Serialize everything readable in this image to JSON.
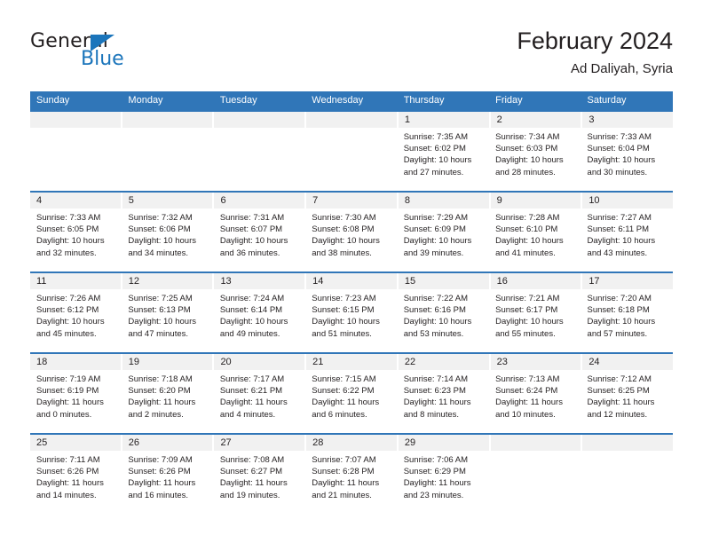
{
  "brand": {
    "name_part1": "General",
    "name_part2": "Blue"
  },
  "header": {
    "title": "February 2024",
    "location": "Ad Daliyah, Syria"
  },
  "colors": {
    "header_blue": "#3076b8",
    "brand_blue": "#1b75bb",
    "daynum_band": "#f1f1f1",
    "text": "#231f20"
  },
  "weekdays": [
    "Sunday",
    "Monday",
    "Tuesday",
    "Wednesday",
    "Thursday",
    "Friday",
    "Saturday"
  ],
  "weeks": [
    [
      {
        "day": "",
        "sunrise": "",
        "sunset": "",
        "daylight": ""
      },
      {
        "day": "",
        "sunrise": "",
        "sunset": "",
        "daylight": ""
      },
      {
        "day": "",
        "sunrise": "",
        "sunset": "",
        "daylight": ""
      },
      {
        "day": "",
        "sunrise": "",
        "sunset": "",
        "daylight": ""
      },
      {
        "day": "1",
        "sunrise": "Sunrise: 7:35 AM",
        "sunset": "Sunset: 6:02 PM",
        "daylight": "Daylight: 10 hours and 27 minutes."
      },
      {
        "day": "2",
        "sunrise": "Sunrise: 7:34 AM",
        "sunset": "Sunset: 6:03 PM",
        "daylight": "Daylight: 10 hours and 28 minutes."
      },
      {
        "day": "3",
        "sunrise": "Sunrise: 7:33 AM",
        "sunset": "Sunset: 6:04 PM",
        "daylight": "Daylight: 10 hours and 30 minutes."
      }
    ],
    [
      {
        "day": "4",
        "sunrise": "Sunrise: 7:33 AM",
        "sunset": "Sunset: 6:05 PM",
        "daylight": "Daylight: 10 hours and 32 minutes."
      },
      {
        "day": "5",
        "sunrise": "Sunrise: 7:32 AM",
        "sunset": "Sunset: 6:06 PM",
        "daylight": "Daylight: 10 hours and 34 minutes."
      },
      {
        "day": "6",
        "sunrise": "Sunrise: 7:31 AM",
        "sunset": "Sunset: 6:07 PM",
        "daylight": "Daylight: 10 hours and 36 minutes."
      },
      {
        "day": "7",
        "sunrise": "Sunrise: 7:30 AM",
        "sunset": "Sunset: 6:08 PM",
        "daylight": "Daylight: 10 hours and 38 minutes."
      },
      {
        "day": "8",
        "sunrise": "Sunrise: 7:29 AM",
        "sunset": "Sunset: 6:09 PM",
        "daylight": "Daylight: 10 hours and 39 minutes."
      },
      {
        "day": "9",
        "sunrise": "Sunrise: 7:28 AM",
        "sunset": "Sunset: 6:10 PM",
        "daylight": "Daylight: 10 hours and 41 minutes."
      },
      {
        "day": "10",
        "sunrise": "Sunrise: 7:27 AM",
        "sunset": "Sunset: 6:11 PM",
        "daylight": "Daylight: 10 hours and 43 minutes."
      }
    ],
    [
      {
        "day": "11",
        "sunrise": "Sunrise: 7:26 AM",
        "sunset": "Sunset: 6:12 PM",
        "daylight": "Daylight: 10 hours and 45 minutes."
      },
      {
        "day": "12",
        "sunrise": "Sunrise: 7:25 AM",
        "sunset": "Sunset: 6:13 PM",
        "daylight": "Daylight: 10 hours and 47 minutes."
      },
      {
        "day": "13",
        "sunrise": "Sunrise: 7:24 AM",
        "sunset": "Sunset: 6:14 PM",
        "daylight": "Daylight: 10 hours and 49 minutes."
      },
      {
        "day": "14",
        "sunrise": "Sunrise: 7:23 AM",
        "sunset": "Sunset: 6:15 PM",
        "daylight": "Daylight: 10 hours and 51 minutes."
      },
      {
        "day": "15",
        "sunrise": "Sunrise: 7:22 AM",
        "sunset": "Sunset: 6:16 PM",
        "daylight": "Daylight: 10 hours and 53 minutes."
      },
      {
        "day": "16",
        "sunrise": "Sunrise: 7:21 AM",
        "sunset": "Sunset: 6:17 PM",
        "daylight": "Daylight: 10 hours and 55 minutes."
      },
      {
        "day": "17",
        "sunrise": "Sunrise: 7:20 AM",
        "sunset": "Sunset: 6:18 PM",
        "daylight": "Daylight: 10 hours and 57 minutes."
      }
    ],
    [
      {
        "day": "18",
        "sunrise": "Sunrise: 7:19 AM",
        "sunset": "Sunset: 6:19 PM",
        "daylight": "Daylight: 11 hours and 0 minutes."
      },
      {
        "day": "19",
        "sunrise": "Sunrise: 7:18 AM",
        "sunset": "Sunset: 6:20 PM",
        "daylight": "Daylight: 11 hours and 2 minutes."
      },
      {
        "day": "20",
        "sunrise": "Sunrise: 7:17 AM",
        "sunset": "Sunset: 6:21 PM",
        "daylight": "Daylight: 11 hours and 4 minutes."
      },
      {
        "day": "21",
        "sunrise": "Sunrise: 7:15 AM",
        "sunset": "Sunset: 6:22 PM",
        "daylight": "Daylight: 11 hours and 6 minutes."
      },
      {
        "day": "22",
        "sunrise": "Sunrise: 7:14 AM",
        "sunset": "Sunset: 6:23 PM",
        "daylight": "Daylight: 11 hours and 8 minutes."
      },
      {
        "day": "23",
        "sunrise": "Sunrise: 7:13 AM",
        "sunset": "Sunset: 6:24 PM",
        "daylight": "Daylight: 11 hours and 10 minutes."
      },
      {
        "day": "24",
        "sunrise": "Sunrise: 7:12 AM",
        "sunset": "Sunset: 6:25 PM",
        "daylight": "Daylight: 11 hours and 12 minutes."
      }
    ],
    [
      {
        "day": "25",
        "sunrise": "Sunrise: 7:11 AM",
        "sunset": "Sunset: 6:26 PM",
        "daylight": "Daylight: 11 hours and 14 minutes."
      },
      {
        "day": "26",
        "sunrise": "Sunrise: 7:09 AM",
        "sunset": "Sunset: 6:26 PM",
        "daylight": "Daylight: 11 hours and 16 minutes."
      },
      {
        "day": "27",
        "sunrise": "Sunrise: 7:08 AM",
        "sunset": "Sunset: 6:27 PM",
        "daylight": "Daylight: 11 hours and 19 minutes."
      },
      {
        "day": "28",
        "sunrise": "Sunrise: 7:07 AM",
        "sunset": "Sunset: 6:28 PM",
        "daylight": "Daylight: 11 hours and 21 minutes."
      },
      {
        "day": "29",
        "sunrise": "Sunrise: 7:06 AM",
        "sunset": "Sunset: 6:29 PM",
        "daylight": "Daylight: 11 hours and 23 minutes."
      },
      {
        "day": "",
        "sunrise": "",
        "sunset": "",
        "daylight": ""
      },
      {
        "day": "",
        "sunrise": "",
        "sunset": "",
        "daylight": ""
      }
    ]
  ]
}
